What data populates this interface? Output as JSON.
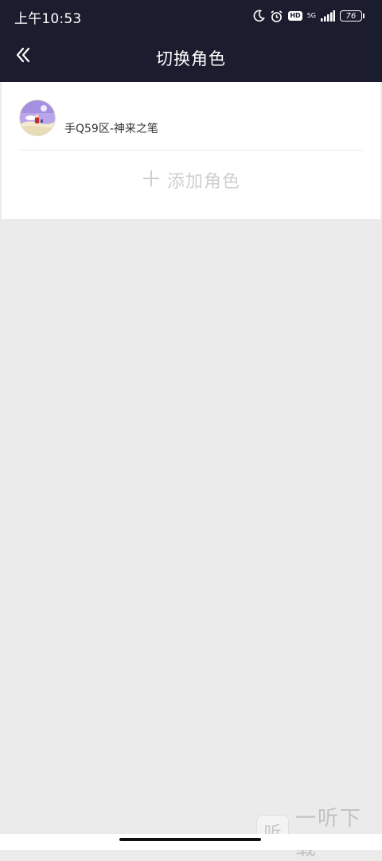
{
  "status_bar": {
    "time": "上午10:53",
    "network": "5G",
    "hd": "HD",
    "battery": "76",
    "icons": [
      "moon-icon",
      "alarm-icon",
      "hd-icon",
      "signal-icon",
      "battery-icon"
    ]
  },
  "header": {
    "title": "切换角色",
    "back_icon": "double-chevron-left-icon"
  },
  "roles": [
    {
      "name": "手Q59区-神来之笔",
      "avatar": "avatar-image"
    }
  ],
  "add_role": {
    "label": "添加角色",
    "icon": "plus-icon"
  },
  "watermark": {
    "icon_glyph": "听",
    "text": "一听下载"
  },
  "colors": {
    "header_bg": "#1b1c2e",
    "page_bg": "#ebebeb",
    "card_bg": "#ffffff",
    "add_text": "#cfcfcf"
  }
}
